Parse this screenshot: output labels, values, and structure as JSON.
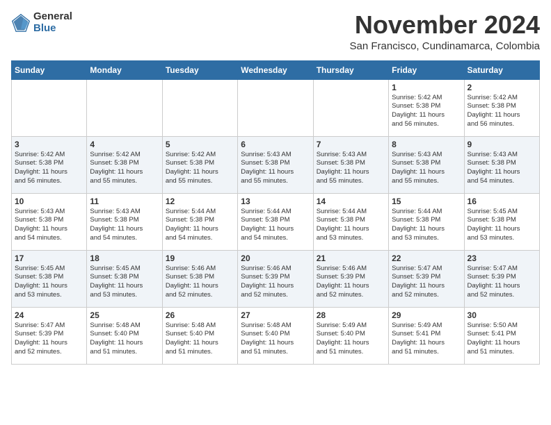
{
  "logo": {
    "general": "General",
    "blue": "Blue"
  },
  "header": {
    "month": "November 2024",
    "location": "San Francisco, Cundinamarca, Colombia"
  },
  "weekdays": [
    "Sunday",
    "Monday",
    "Tuesday",
    "Wednesday",
    "Thursday",
    "Friday",
    "Saturday"
  ],
  "weeks": [
    [
      {
        "day": "",
        "info": ""
      },
      {
        "day": "",
        "info": ""
      },
      {
        "day": "",
        "info": ""
      },
      {
        "day": "",
        "info": ""
      },
      {
        "day": "",
        "info": ""
      },
      {
        "day": "1",
        "info": "Sunrise: 5:42 AM\nSunset: 5:38 PM\nDaylight: 11 hours\nand 56 minutes."
      },
      {
        "day": "2",
        "info": "Sunrise: 5:42 AM\nSunset: 5:38 PM\nDaylight: 11 hours\nand 56 minutes."
      }
    ],
    [
      {
        "day": "3",
        "info": "Sunrise: 5:42 AM\nSunset: 5:38 PM\nDaylight: 11 hours\nand 56 minutes."
      },
      {
        "day": "4",
        "info": "Sunrise: 5:42 AM\nSunset: 5:38 PM\nDaylight: 11 hours\nand 55 minutes."
      },
      {
        "day": "5",
        "info": "Sunrise: 5:42 AM\nSunset: 5:38 PM\nDaylight: 11 hours\nand 55 minutes."
      },
      {
        "day": "6",
        "info": "Sunrise: 5:43 AM\nSunset: 5:38 PM\nDaylight: 11 hours\nand 55 minutes."
      },
      {
        "day": "7",
        "info": "Sunrise: 5:43 AM\nSunset: 5:38 PM\nDaylight: 11 hours\nand 55 minutes."
      },
      {
        "day": "8",
        "info": "Sunrise: 5:43 AM\nSunset: 5:38 PM\nDaylight: 11 hours\nand 55 minutes."
      },
      {
        "day": "9",
        "info": "Sunrise: 5:43 AM\nSunset: 5:38 PM\nDaylight: 11 hours\nand 54 minutes."
      }
    ],
    [
      {
        "day": "10",
        "info": "Sunrise: 5:43 AM\nSunset: 5:38 PM\nDaylight: 11 hours\nand 54 minutes."
      },
      {
        "day": "11",
        "info": "Sunrise: 5:43 AM\nSunset: 5:38 PM\nDaylight: 11 hours\nand 54 minutes."
      },
      {
        "day": "12",
        "info": "Sunrise: 5:44 AM\nSunset: 5:38 PM\nDaylight: 11 hours\nand 54 minutes."
      },
      {
        "day": "13",
        "info": "Sunrise: 5:44 AM\nSunset: 5:38 PM\nDaylight: 11 hours\nand 54 minutes."
      },
      {
        "day": "14",
        "info": "Sunrise: 5:44 AM\nSunset: 5:38 PM\nDaylight: 11 hours\nand 53 minutes."
      },
      {
        "day": "15",
        "info": "Sunrise: 5:44 AM\nSunset: 5:38 PM\nDaylight: 11 hours\nand 53 minutes."
      },
      {
        "day": "16",
        "info": "Sunrise: 5:45 AM\nSunset: 5:38 PM\nDaylight: 11 hours\nand 53 minutes."
      }
    ],
    [
      {
        "day": "17",
        "info": "Sunrise: 5:45 AM\nSunset: 5:38 PM\nDaylight: 11 hours\nand 53 minutes."
      },
      {
        "day": "18",
        "info": "Sunrise: 5:45 AM\nSunset: 5:38 PM\nDaylight: 11 hours\nand 53 minutes."
      },
      {
        "day": "19",
        "info": "Sunrise: 5:46 AM\nSunset: 5:38 PM\nDaylight: 11 hours\nand 52 minutes."
      },
      {
        "day": "20",
        "info": "Sunrise: 5:46 AM\nSunset: 5:39 PM\nDaylight: 11 hours\nand 52 minutes."
      },
      {
        "day": "21",
        "info": "Sunrise: 5:46 AM\nSunset: 5:39 PM\nDaylight: 11 hours\nand 52 minutes."
      },
      {
        "day": "22",
        "info": "Sunrise: 5:47 AM\nSunset: 5:39 PM\nDaylight: 11 hours\nand 52 minutes."
      },
      {
        "day": "23",
        "info": "Sunrise: 5:47 AM\nSunset: 5:39 PM\nDaylight: 11 hours\nand 52 minutes."
      }
    ],
    [
      {
        "day": "24",
        "info": "Sunrise: 5:47 AM\nSunset: 5:39 PM\nDaylight: 11 hours\nand 52 minutes."
      },
      {
        "day": "25",
        "info": "Sunrise: 5:48 AM\nSunset: 5:40 PM\nDaylight: 11 hours\nand 51 minutes."
      },
      {
        "day": "26",
        "info": "Sunrise: 5:48 AM\nSunset: 5:40 PM\nDaylight: 11 hours\nand 51 minutes."
      },
      {
        "day": "27",
        "info": "Sunrise: 5:48 AM\nSunset: 5:40 PM\nDaylight: 11 hours\nand 51 minutes."
      },
      {
        "day": "28",
        "info": "Sunrise: 5:49 AM\nSunset: 5:40 PM\nDaylight: 11 hours\nand 51 minutes."
      },
      {
        "day": "29",
        "info": "Sunrise: 5:49 AM\nSunset: 5:41 PM\nDaylight: 11 hours\nand 51 minutes."
      },
      {
        "day": "30",
        "info": "Sunrise: 5:50 AM\nSunset: 5:41 PM\nDaylight: 11 hours\nand 51 minutes."
      }
    ]
  ]
}
